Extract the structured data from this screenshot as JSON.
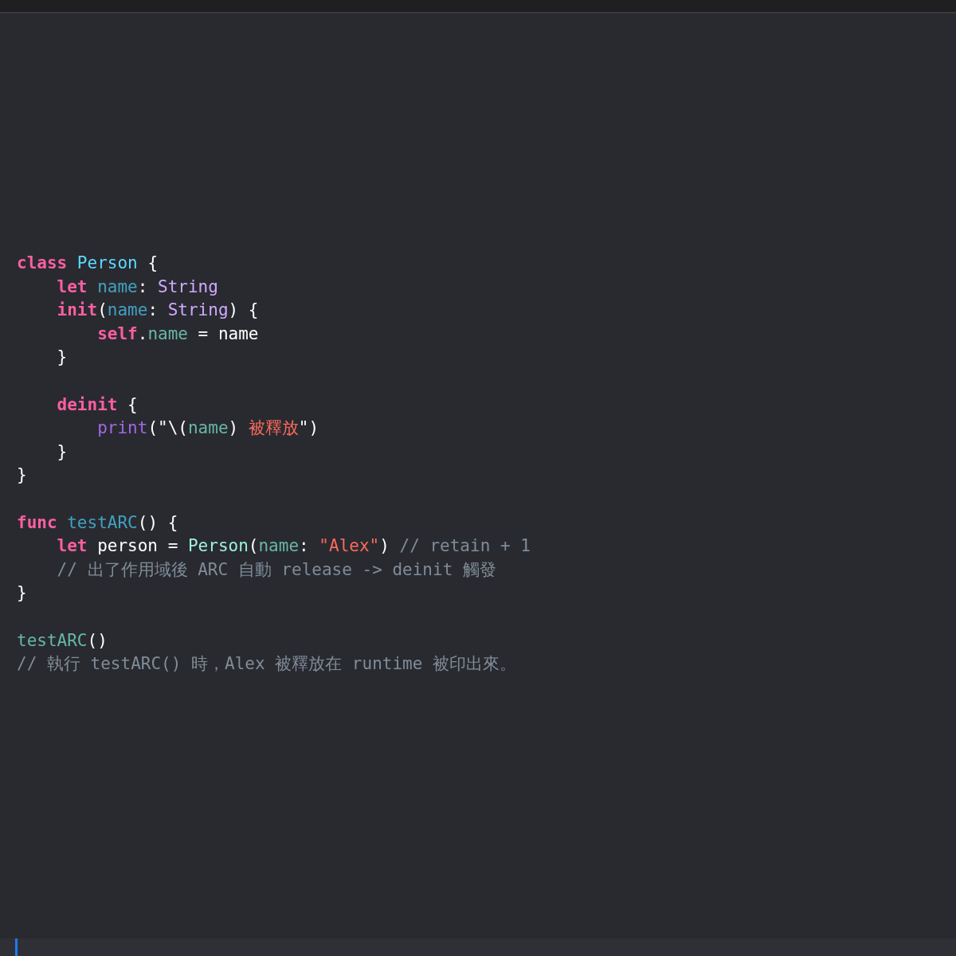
{
  "editor": {
    "blocks": [
      {
        "lines": [
          {
            "tokens": [
              {
                "text": "class",
                "kind": "keyword"
              },
              {
                "text": " Person",
                "kind": "type_decl"
              },
              {
                "text": " {",
                "kind": "plain"
              }
            ]
          },
          {
            "tokens": [
              {
                "text": "    let",
                "kind": "keyword"
              },
              {
                "text": " name",
                "kind": "property"
              },
              {
                "text": ": ",
                "kind": "plain"
              },
              {
                "text": "String",
                "kind": "type_ref"
              }
            ]
          },
          {
            "tokens": [
              {
                "text": "    init",
                "kind": "keyword"
              },
              {
                "text": "(",
                "kind": "plain"
              },
              {
                "text": "name",
                "kind": "property"
              },
              {
                "text": ": ",
                "kind": "plain"
              },
              {
                "text": "String",
                "kind": "type_ref"
              },
              {
                "text": ") {",
                "kind": "plain"
              }
            ]
          },
          {
            "tokens": [
              {
                "text": "        self",
                "kind": "keyword"
              },
              {
                "text": ".",
                "kind": "plain"
              },
              {
                "text": "name",
                "kind": "member"
              },
              {
                "text": " = name",
                "kind": "plain"
              }
            ]
          },
          {
            "tokens": [
              {
                "text": "    }",
                "kind": "plain"
              }
            ]
          }
        ]
      },
      {
        "lines": [
          {
            "tokens": [
              {
                "text": "    deinit",
                "kind": "keyword"
              },
              {
                "text": " {",
                "kind": "plain"
              }
            ]
          },
          {
            "tokens": [
              {
                "text": "        print",
                "kind": "function_ref"
              },
              {
                "text": "(",
                "kind": "plain"
              },
              {
                "text": "\"\\(",
                "kind": "plain"
              },
              {
                "text": "name",
                "kind": "member"
              },
              {
                "text": ") ",
                "kind": "plain"
              },
              {
                "text": "被釋放",
                "kind": "string"
              },
              {
                "text": "\"",
                "kind": "plain"
              },
              {
                "text": ")",
                "kind": "plain"
              }
            ]
          },
          {
            "tokens": [
              {
                "text": "    }",
                "kind": "plain"
              }
            ]
          },
          {
            "tokens": [
              {
                "text": "}",
                "kind": "plain"
              }
            ]
          }
        ]
      },
      {
        "lines": [
          {
            "tokens": [
              {
                "text": "func",
                "kind": "keyword"
              },
              {
                "text": " testARC",
                "kind": "func_decl"
              },
              {
                "text": "() {",
                "kind": "plain"
              }
            ]
          },
          {
            "tokens": [
              {
                "text": "    let",
                "kind": "keyword"
              },
              {
                "text": " person = ",
                "kind": "plain"
              },
              {
                "text": "Person",
                "kind": "class_ref"
              },
              {
                "text": "(",
                "kind": "plain"
              },
              {
                "text": "name",
                "kind": "member"
              },
              {
                "text": ": ",
                "kind": "plain"
              },
              {
                "text": "\"Alex\"",
                "kind": "string"
              },
              {
                "text": ") ",
                "kind": "plain"
              },
              {
                "text": "// retain + 1",
                "kind": "comment"
              }
            ]
          },
          {
            "tokens": [
              {
                "text": "    // 出了作用域後 ARC 自動 release -> deinit 觸發",
                "kind": "comment"
              }
            ]
          },
          {
            "tokens": [
              {
                "text": "}",
                "kind": "plain"
              }
            ]
          }
        ]
      },
      {
        "lines": [
          {
            "tokens": [
              {
                "text": "testARC",
                "kind": "call"
              },
              {
                "text": "()",
                "kind": "plain"
              }
            ]
          },
          {
            "tokens": [
              {
                "text": "// 執行 testARC() 時，Alex 被釋放在 runtime 被印出來。",
                "kind": "comment"
              }
            ]
          }
        ]
      }
    ]
  }
}
